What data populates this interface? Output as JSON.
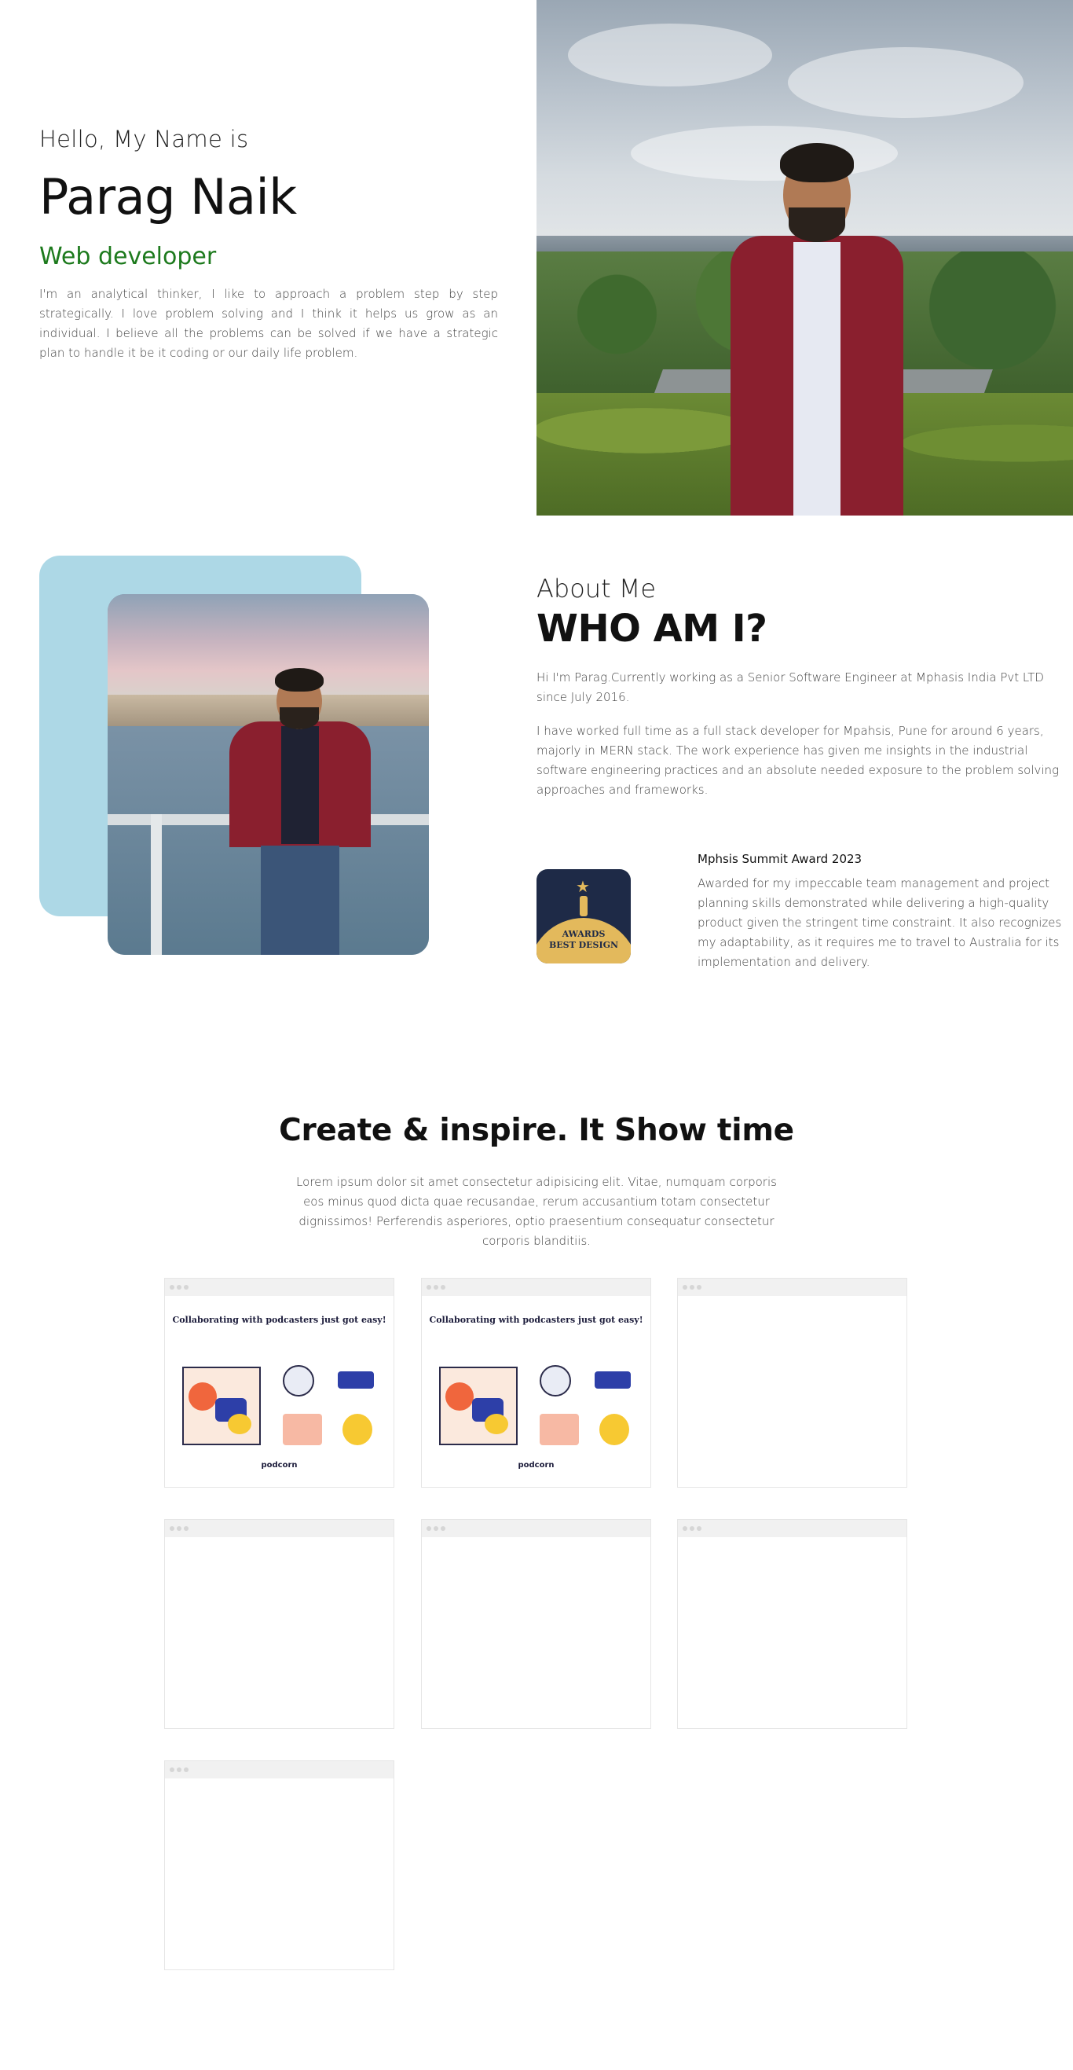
{
  "hero": {
    "greeting": "Hello, My Name is",
    "name": "Parag Naik",
    "role": "Web developer",
    "bio": "I'm an analytical thinker, I like to approach a problem step by step strategically. I love problem solving and I think it helps us grow as an individual. I believe all the problems can be solved if we have a strategic plan to handle it be it coding or our daily life problem."
  },
  "about": {
    "kicker": "About Me",
    "title": "WHO AM I?",
    "intro": "Hi I'm Parag.Currently working as a Senior Software Engineer at Mphasis India Pvt LTD since July 2016.",
    "experience": "I have worked full time as a full stack developer for Mpahsis, Pune for around 6 years, majorly in MERN stack. The work experience has given me insights in the industrial software engineering practices and an absolute needed exposure to the problem solving approaches and frameworks.",
    "award": {
      "badge_line1": "AWARDS",
      "badge_line2": "BEST DESIGN",
      "title": "Mphsis Summit Award 2023",
      "description": "Awarded for my impeccable team management and project planning skills demonstrated while delivering a high-quality product given the stringent time constraint. It also recognizes my adaptability, as it requires me to travel to Australia for its implementation and delivery."
    }
  },
  "projects": {
    "title": "Create & inspire. It Show time",
    "description": "Lorem ipsum dolor sit amet consectetur adipisicing elit. Vitae, numquam corporis eos minus quod dicta quae recusandae, rerum accusantium totam consectetur dignissimos! Perferendis asperiores, optio praesentium consequatur consectetur corporis blanditiis.",
    "thumb_headline": "Collaborating with podcasters just got easy!",
    "thumb_brand": "podcorn"
  },
  "colors": {
    "accent_green": "#1d7a1d",
    "about_bg": "#add8e6",
    "jacket": "#8a1f2e",
    "award_navy": "#1e2a47",
    "award_gold": "#e3b95c"
  }
}
